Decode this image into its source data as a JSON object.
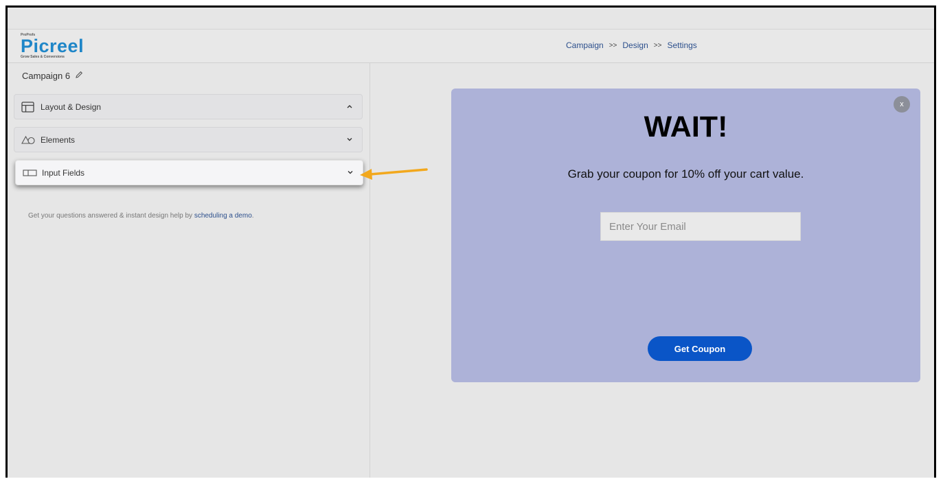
{
  "logo": {
    "small": "ProProfs",
    "name": "Picreel",
    "tagline": "Grow Sales & Conversions"
  },
  "breadcrumb": {
    "step1": "Campaign",
    "sep1": ">>",
    "step2": "Design",
    "sep2": ">>",
    "step3": "Settings"
  },
  "sidebar": {
    "campaign_name": "Campaign 6",
    "sections": [
      {
        "label": "Layout & Design",
        "icon": "layout-icon",
        "state": "expanded"
      },
      {
        "label": "Elements",
        "icon": "shapes-icon",
        "state": "collapsed"
      },
      {
        "label": "Input Fields",
        "icon": "input-field-icon",
        "state": "collapsed"
      }
    ],
    "help_prefix": "Get your questions answered & instant design help by ",
    "help_link": "scheduling a demo",
    "help_suffix": "."
  },
  "popup": {
    "close_label": "x",
    "headline": "WAIT!",
    "subtext": "Grab your coupon for 10% off your cart value.",
    "email_placeholder": "Enter Your Email",
    "button_label": "Get Coupon",
    "background": "#adb2d8",
    "button_color": "#0a55c7"
  },
  "annotation": {
    "arrow_color": "#f2a81d"
  }
}
